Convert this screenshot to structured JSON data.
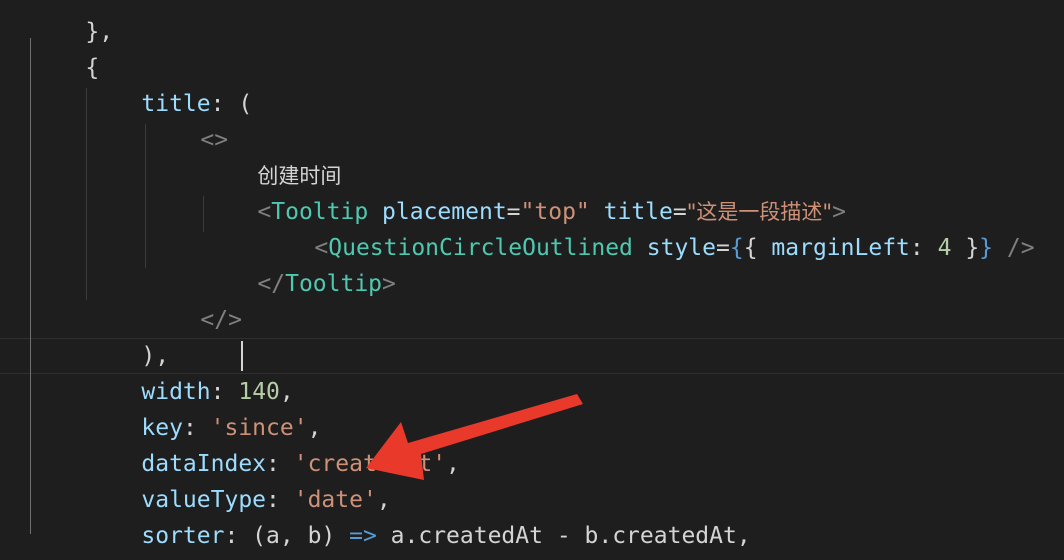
{
  "code": {
    "l0": "},",
    "l1": "{",
    "l2_prop": "title",
    "l2_rest": ": (",
    "l3": "<>",
    "l4": "创建时间",
    "l5_open": "<",
    "l5_tag": "Tooltip",
    "l5_attr1": "placement",
    "l5_eq1": "=",
    "l5_val1": "\"top\"",
    "l5_attr2": "title",
    "l5_eq2": "=",
    "l5_val2": "\"这是一段描述\"",
    "l5_close": ">",
    "l6_open": "<",
    "l6_tag": "QuestionCircleOutlined",
    "l6_attr": "style",
    "l6_eq": "=",
    "l6_brace_open": "{",
    "l6_obj_open": "{ ",
    "l6_key": "marginLeft",
    "l6_colon": ": ",
    "l6_num": "4",
    "l6_obj_close": " }",
    "l6_brace_close": "}",
    "l6_selfclose": " />",
    "l7_open": "</",
    "l7_tag": "Tooltip",
    "l7_close": ">",
    "l8": "</>",
    "l9": "),",
    "l10_prop": "width",
    "l10_colon": ": ",
    "l10_num": "140",
    "l10_comma": ",",
    "l11_prop": "key",
    "l11_colon": ": ",
    "l11_str": "'since'",
    "l11_comma": ",",
    "l12_prop": "dataIndex",
    "l12_colon": ": ",
    "l12_str": "'createdAt'",
    "l12_comma": ",",
    "l13_prop": "valueType",
    "l13_colon": ": ",
    "l13_str": "'date'",
    "l13_comma": ",",
    "l14_prop": "sorter",
    "l14_a": ": (a, b) ",
    "l14_arrow": "=>",
    "l14_b": " a.createdAt - b.createdAt,",
    "l15": "},"
  },
  "colors": {
    "background": "#1e1e1e",
    "property": "#9cdcfe",
    "string": "#ce9178",
    "number": "#b5cea8",
    "tag": "#4ec9b0",
    "keyword": "#569cd6",
    "annotation_arrow": "#e8392b"
  },
  "annotation": {
    "icon": "red-arrow-icon"
  }
}
